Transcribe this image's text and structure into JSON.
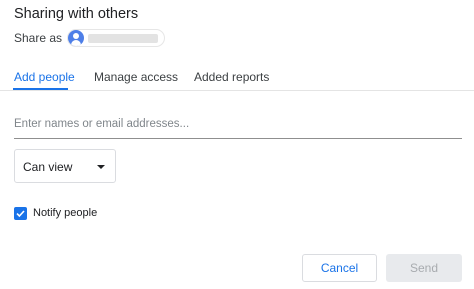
{
  "dialog": {
    "title": "Sharing with others"
  },
  "share_as": {
    "label": "Share as",
    "account_icon": "account-avatar-icon"
  },
  "tabs": [
    {
      "label": "Add people",
      "active": true
    },
    {
      "label": "Manage access",
      "active": false
    },
    {
      "label": "Added reports",
      "active": false
    }
  ],
  "email_input": {
    "value": "",
    "placeholder": "Enter names or email addresses..."
  },
  "role_select": {
    "selected": "Can view",
    "icon": "caret-down-icon"
  },
  "notify": {
    "label": "Notify people",
    "checked": true,
    "icon": "checkmark-icon"
  },
  "buttons": {
    "cancel": "Cancel",
    "send": "Send",
    "send_enabled": false
  },
  "colors": {
    "accent": "#1a73e8",
    "divider": "#e4e4e4",
    "disabled_bg": "#e8eaed",
    "disabled_text": "#a8abaf"
  }
}
